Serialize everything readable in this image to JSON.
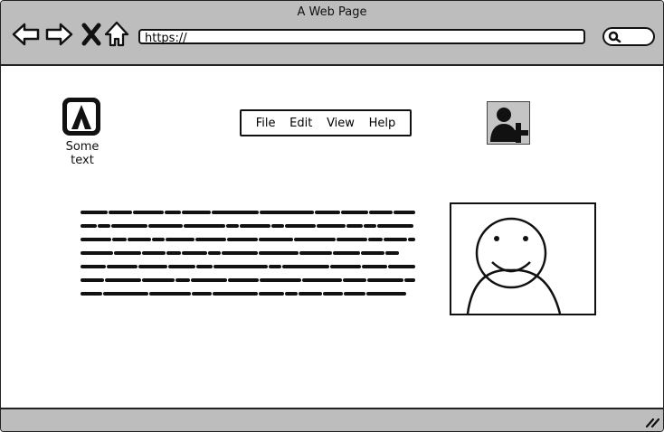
{
  "window": {
    "title": "A Web Page"
  },
  "toolbar": {
    "url": "https://",
    "icons": [
      "back-icon",
      "forward-icon",
      "close-icon",
      "home-icon",
      "search-icon"
    ]
  },
  "page": {
    "logo_label": "Some text",
    "menu": [
      "File",
      "Edit",
      "View",
      "Help"
    ],
    "user_icon": "add-user-icon",
    "image_icon": "smiley-face-image"
  },
  "colors": {
    "chrome": "#bdbdbd",
    "ink": "#111111",
    "user_bg": "#c4c4c4"
  }
}
